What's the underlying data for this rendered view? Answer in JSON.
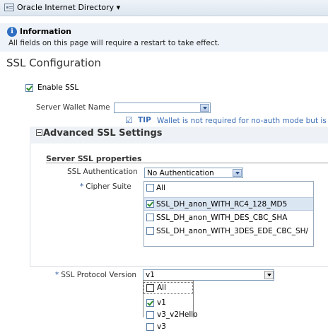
{
  "header": {
    "app_title": "Oracle Internet Directory ▾"
  },
  "info": {
    "title": "Information",
    "text": "All fields on this page will require a restart to take effect."
  },
  "page": {
    "title": "SSL Configuration"
  },
  "enable_ssl": {
    "label": "Enable SSL",
    "checked": true
  },
  "wallet": {
    "label": "Server Wallet Name",
    "value": ""
  },
  "tip": {
    "label": "TIP",
    "text": "Wallet is not required for no-auth mode but is nee"
  },
  "advanced": {
    "title": "Advanced SSL Settings",
    "section_title": "Server SSL properties"
  },
  "ssl_auth": {
    "label": "SSL Authentication",
    "value": "No Authentication"
  },
  "cipher": {
    "required_mark": "*",
    "label": "Cipher Suite",
    "options": [
      {
        "label": "All",
        "checked": false
      },
      {
        "label": "SSL_DH_anon_WITH_RC4_128_MD5",
        "checked": true
      },
      {
        "label": "SSL_DH_anon_WITH_DES_CBC_SHA",
        "checked": false
      },
      {
        "label": "SSL_DH_anon_WITH_3DES_EDE_CBC_SH/",
        "checked": false
      }
    ]
  },
  "protocol": {
    "required_mark": "*",
    "label": "SSL Protocol Version",
    "value": "v1",
    "options": [
      {
        "label": "All",
        "checked": false
      },
      {
        "label": "v1",
        "checked": true
      },
      {
        "label": "v3_v2Hello",
        "checked": false
      },
      {
        "label": "v3",
        "checked": false
      }
    ]
  },
  "colors": {
    "accent": "#3a6db5",
    "info_bg": "#eef3f9",
    "selection_bg": "#dbe6f3"
  }
}
